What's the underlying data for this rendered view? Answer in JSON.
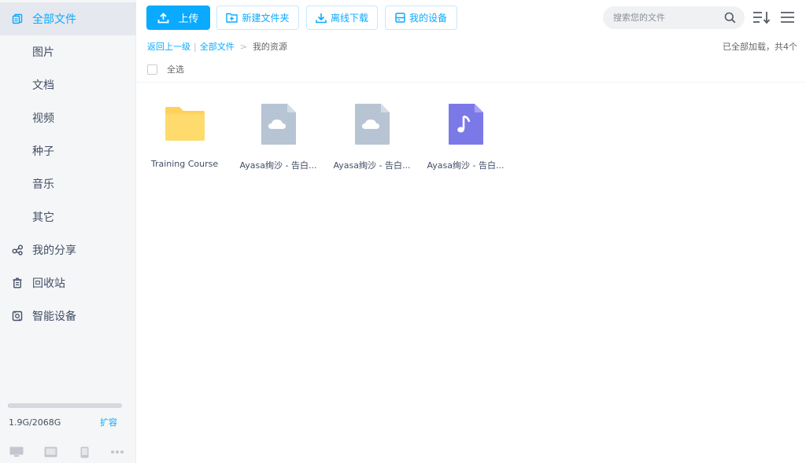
{
  "sidebar": {
    "items": [
      {
        "label": "全部文件",
        "icon": "files-icon",
        "active": true,
        "sub": false
      },
      {
        "label": "图片",
        "sub": true
      },
      {
        "label": "文档",
        "sub": true
      },
      {
        "label": "视频",
        "sub": true
      },
      {
        "label": "种子",
        "sub": true
      },
      {
        "label": "音乐",
        "sub": true
      },
      {
        "label": "其它",
        "sub": true
      },
      {
        "label": "我的分享",
        "icon": "share-icon",
        "sub": false
      },
      {
        "label": "回收站",
        "icon": "trash-icon",
        "sub": false
      },
      {
        "label": "智能设备",
        "icon": "device-icon",
        "sub": false
      }
    ],
    "quota": {
      "text": "1.9G/2068G",
      "used_fraction": 0.001,
      "expand_label": "扩容"
    }
  },
  "toolbar": {
    "upload_label": "上传",
    "new_folder_label": "新建文件夹",
    "offline_download_label": "离线下载",
    "my_devices_label": "我的设备"
  },
  "search": {
    "placeholder": "搜索您的文件"
  },
  "breadcrumb": {
    "back_label": "返回上一级",
    "all_files_label": "全部文件",
    "separator": ">",
    "current_label": "我的资源"
  },
  "status": {
    "loaded_text": "已全部加载，共4个"
  },
  "select_all_label": "全选",
  "files": [
    {
      "name": "Training Course",
      "type": "folder"
    },
    {
      "name": "Ayasa绚沙 - 告白...",
      "type": "cloud-file"
    },
    {
      "name": "Ayasa绚沙 - 告白...",
      "type": "cloud-file"
    },
    {
      "name": "Ayasa绚沙 - 告白...",
      "type": "music"
    }
  ],
  "colors": {
    "accent": "#09aaff",
    "folder": "#ffd15c",
    "cloud_file": "#b7c4d3",
    "music_file": "#7b79e8"
  }
}
